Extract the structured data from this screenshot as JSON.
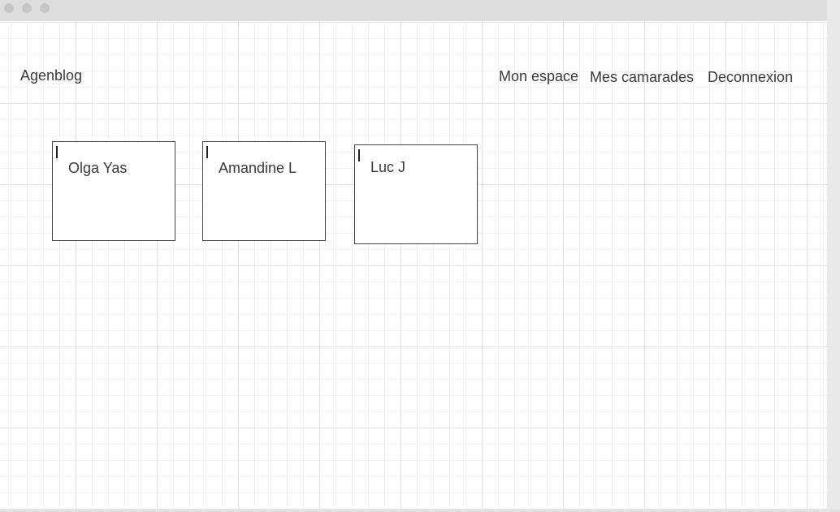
{
  "header": {
    "brand": "Agenblog",
    "nav": [
      {
        "label": "Mon espace"
      },
      {
        "label": "Mes camarades"
      },
      {
        "label": "Deconnexion"
      }
    ]
  },
  "classmates": [
    {
      "name": "Olga Yas"
    },
    {
      "name": "Amandine L"
    },
    {
      "name": "Luc J"
    }
  ],
  "colors": {
    "titlebar": "#dddddd",
    "grid_major": "#e2e2e2",
    "grid_minor": "#f1f1f1",
    "text": "#3a3a3a",
    "card_border": "#444444"
  }
}
